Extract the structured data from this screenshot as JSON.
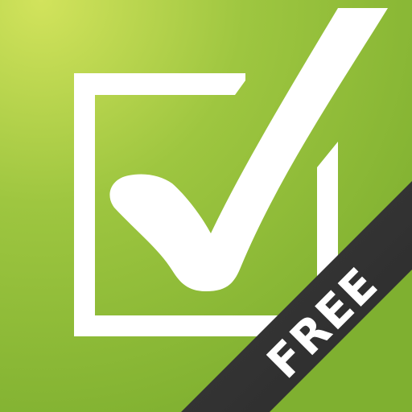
{
  "icon": {
    "name": "checklist-app-icon",
    "symbol": "checkbox-checkmark-icon",
    "background_color_light": "#c9e055",
    "background_color_dark": "#87b532",
    "mark_color": "#ffffff"
  },
  "ribbon": {
    "label": "FREE",
    "color": "#3a3a3a",
    "text_color": "#ffffff"
  }
}
